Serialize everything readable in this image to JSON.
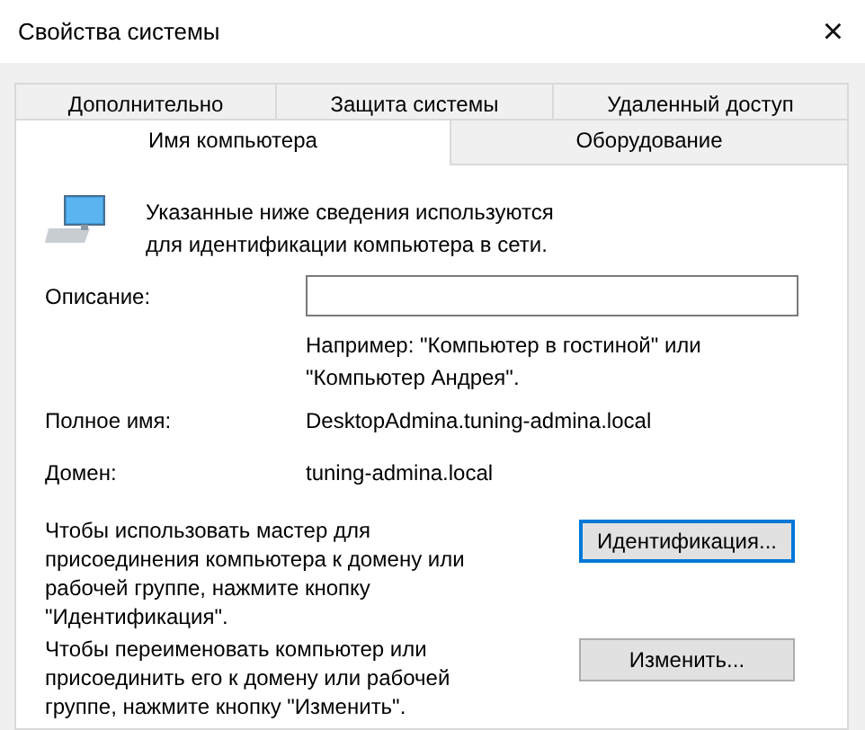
{
  "window": {
    "title": "Свойства системы",
    "close": "×"
  },
  "tab_rows": [
    {
      "tabs": [
        {
          "label": "Дополнительно",
          "selected": false
        },
        {
          "label": "Защита системы",
          "selected": false
        },
        {
          "label": "Удаленный доступ",
          "selected": false
        }
      ]
    },
    {
      "tabs": [
        {
          "label": "Имя компьютера",
          "selected": true
        },
        {
          "label": "Оборудование",
          "selected": false
        }
      ]
    }
  ],
  "panel": {
    "intro": "Указанные ниже сведения используются для идентификации компьютера в сети.",
    "description": {
      "label": "Описание:"
    },
    "hint": "Например: \"Компьютер в гостиной\" или \"Компьютер Андрея\".",
    "fields": [
      {
        "label": "Полное имя:",
        "value": "DesktopAdmina.tuning-admina.local"
      },
      {
        "label": "Домен:",
        "value": "tuning-admina.local"
      }
    ],
    "actions": [
      {
        "text": "Чтобы использовать мастер для присоединения компьютера к домену или рабочей группе, нажмите кнопку \"Идентификация\".",
        "button": "Идентификация...",
        "focused": true
      },
      {
        "text": "Чтобы переименовать компьютер или присоединить его к домену или рабочей группе, нажмите кнопку \"Изменить\".",
        "button": "Изменить...",
        "focused": false
      }
    ]
  }
}
